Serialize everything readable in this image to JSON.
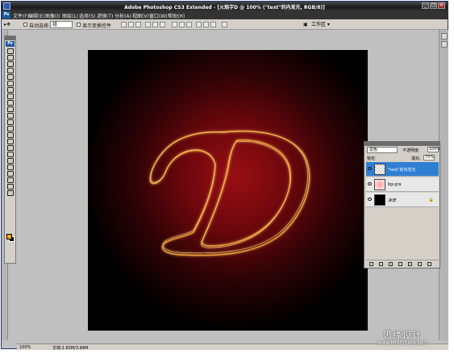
{
  "window": {
    "title": "Adobe Photoshop CS3 Extended - [火焰字D @ 100% (\"text\"的内发光, RGB/8)]",
    "minimize_glyph": "_",
    "maximize_glyph": "□",
    "close_glyph": "×"
  },
  "app_logo_text": "Ps",
  "menu": {
    "items": [
      {
        "label": "文件(F)"
      },
      {
        "label": "编辑(E)"
      },
      {
        "label": "图像(I)"
      },
      {
        "label": "图层(L)"
      },
      {
        "label": "选择(S)"
      },
      {
        "label": "滤镜(T)"
      },
      {
        "label": "分析(A)"
      },
      {
        "label": "视图(V)"
      },
      {
        "label": "窗口(W)"
      },
      {
        "label": "帮助(H)"
      }
    ]
  },
  "options_bar": {
    "auto_select_label": "自动选择:",
    "auto_select_value": "组",
    "show_transform_label": "显示变换控件",
    "workspace_label": "工作区 ▾"
  },
  "toolbox": {
    "logo": "Ps",
    "foreground_color": "#f5a800",
    "background_color": "#000000"
  },
  "canvas": {
    "letter": "D",
    "stroke_color": "#e8a23a",
    "glow_color": "#9a0f14"
  },
  "status_bar": {
    "zoom": "100%",
    "doc_info": "文档:1.83M/3.84M"
  },
  "layers_panel": {
    "blend_mode": "滤色",
    "opacity_label": "不透明度:",
    "opacity_value": "100%",
    "lock_label": "锁定:",
    "fill_label": "填充:",
    "fill_value": "75%",
    "layers": [
      {
        "name": "\"text\"的内发光",
        "active": true,
        "thumb": "checker"
      },
      {
        "name": "bg-gra",
        "active": false,
        "thumb": "glow"
      },
      {
        "name": "背景",
        "active": false,
        "thumb": "black",
        "locked": true
      }
    ],
    "lock_icon": "🔒"
  },
  "watermark": {
    "cn": "思缘设计",
    "url": "www.MISSYUAN.NET"
  }
}
